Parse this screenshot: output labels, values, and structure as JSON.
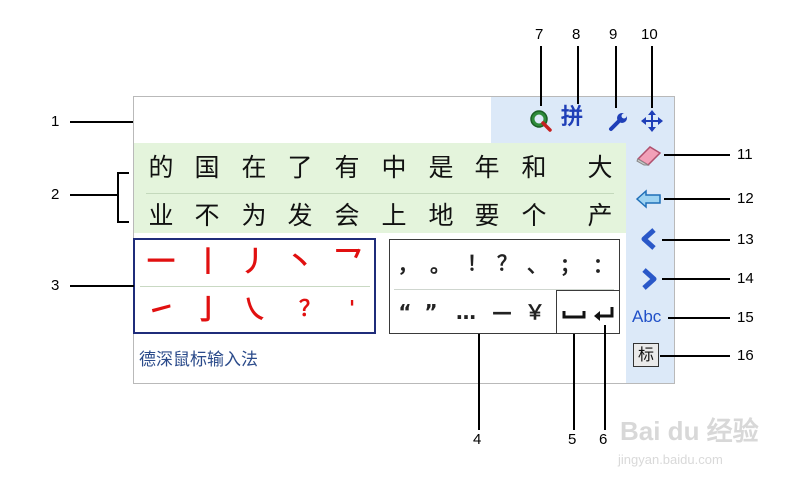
{
  "callouts": [
    "1",
    "2",
    "3",
    "4",
    "5",
    "6",
    "7",
    "8",
    "9",
    "10",
    "11",
    "12",
    "13",
    "14",
    "15",
    "16"
  ],
  "candidates": {
    "row1": [
      "的",
      "国",
      "在",
      "了",
      "有",
      "中",
      "是",
      "年",
      "和",
      "大"
    ],
    "row2": [
      "业",
      "不",
      "为",
      "发",
      "会",
      "上",
      "地",
      "要",
      "个",
      "产"
    ]
  },
  "strokes": {
    "row1": [
      "一",
      "丨",
      "丿",
      "丶",
      "乛"
    ],
    "row2": [
      "㇀",
      "亅",
      "㇏",
      "？",
      "'"
    ]
  },
  "punctuation": {
    "row1": [
      "，",
      "。",
      "！",
      "？",
      "、",
      "；",
      "："
    ],
    "row2": [
      "“",
      "”",
      "…",
      "—",
      "￥"
    ]
  },
  "keys": {
    "space_glyph": "⎵",
    "enter_glyph": "↵"
  },
  "toolbar": {
    "pinyin_label": "拼"
  },
  "sidebar": {
    "abc_label": "Abc",
    "biao_label": "标"
  },
  "brand": "德深鼠标输入法",
  "watermark": {
    "logo_text": "Bai du 经验",
    "url": "jingyan.baidu.com"
  },
  "colors": {
    "stroke_red": "#e11010",
    "frame_blue": "#1f2c7a",
    "panel_blue": "#dce9f8",
    "candidate_green": "#e4f4dc"
  }
}
